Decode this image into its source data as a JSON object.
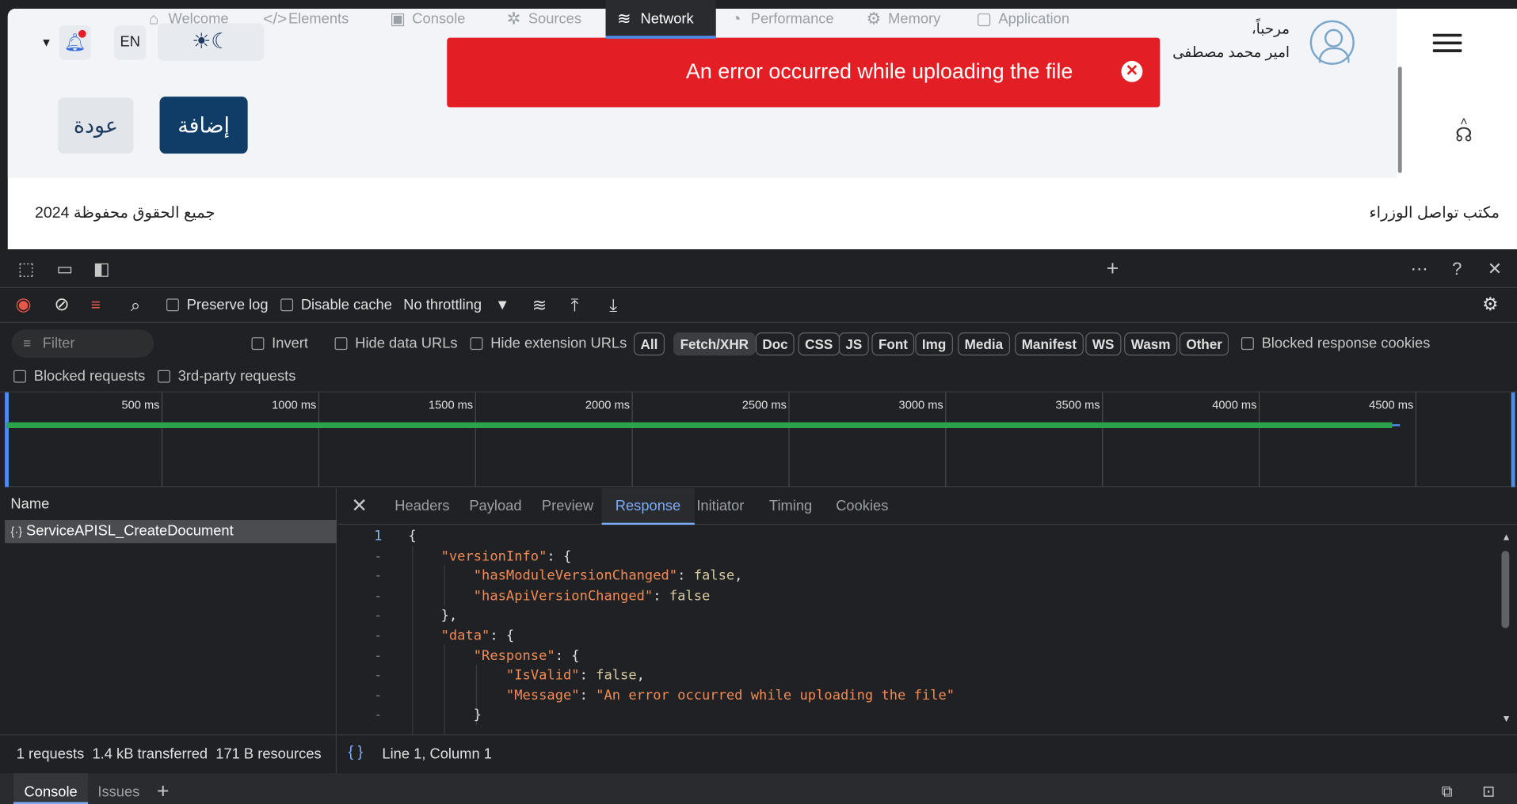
{
  "page": {
    "greeting": "مرحباً،",
    "user_name": "امير محمد مصطفى",
    "toast_message": "An error occurred while uploading the file",
    "toast_close_icon": "close-circle-icon",
    "theme_icon": "sun-moon-icon",
    "language": "EN",
    "bell_icon": "bell-icon",
    "add_button": "إضافة",
    "back_button": "عودة",
    "footer_org": "مكتب تواصل الوزراء",
    "footer_rights": "جميع الحقوق محفوظة 2024",
    "support_icon": "headset-icon"
  },
  "devtools": {
    "tabs": [
      {
        "label": "Welcome",
        "icon": "home-icon"
      },
      {
        "label": "Elements",
        "icon": "code-icon"
      },
      {
        "label": "Console",
        "icon": "console-icon"
      },
      {
        "label": "Sources",
        "icon": "bug-icon"
      },
      {
        "label": "Network",
        "icon": "wifi-icon"
      },
      {
        "label": "Performance",
        "icon": "gauge-icon"
      },
      {
        "label": "Memory",
        "icon": "chip-icon"
      },
      {
        "label": "Application",
        "icon": "window-icon"
      }
    ],
    "toolbar": {
      "preserve_log": "Preserve log",
      "disable_cache": "Disable cache",
      "throttling": "No throttling"
    },
    "filter": {
      "placeholder": "Filter",
      "invert": "Invert",
      "hide_data_urls": "Hide data URLs",
      "hide_extension_urls": "Hide extension URLs",
      "types": [
        "All",
        "Fetch/XHR",
        "Doc",
        "CSS",
        "JS",
        "Font",
        "Img",
        "Media",
        "Manifest",
        "WS",
        "Wasm",
        "Other"
      ],
      "blocked_response_cookies": "Blocked response cookies",
      "blocked_requests": "Blocked requests",
      "third_party": "3rd-party requests"
    },
    "timeline": {
      "ticks": [
        "500 ms",
        "1000 ms",
        "1500 ms",
        "2000 ms",
        "2500 ms",
        "3000 ms",
        "3500 ms",
        "4000 ms",
        "4500 ms"
      ]
    },
    "requests": {
      "header": "Name",
      "items": [
        "ServiceAPISL_CreateDocument"
      ]
    },
    "detail_tabs": [
      "Headers",
      "Payload",
      "Preview",
      "Response",
      "Initiator",
      "Timing",
      "Cookies"
    ],
    "response_lines": [
      "{",
      "    \"versionInfo\": {",
      "        \"hasModuleVersionChanged\": false,",
      "        \"hasApiVersionChanged\": false",
      "    },",
      "    \"data\": {",
      "        \"Response\": {",
      "            \"IsValid\": false,",
      "            \"Message\": \"An error occurred while uploading the file\"",
      "        }"
    ],
    "status": {
      "summary": "1 requests  1.4 kB transferred  171 B resources",
      "cursor": "Line 1, Column 1"
    },
    "drawer": {
      "console": "Console",
      "issues": "Issues"
    }
  }
}
